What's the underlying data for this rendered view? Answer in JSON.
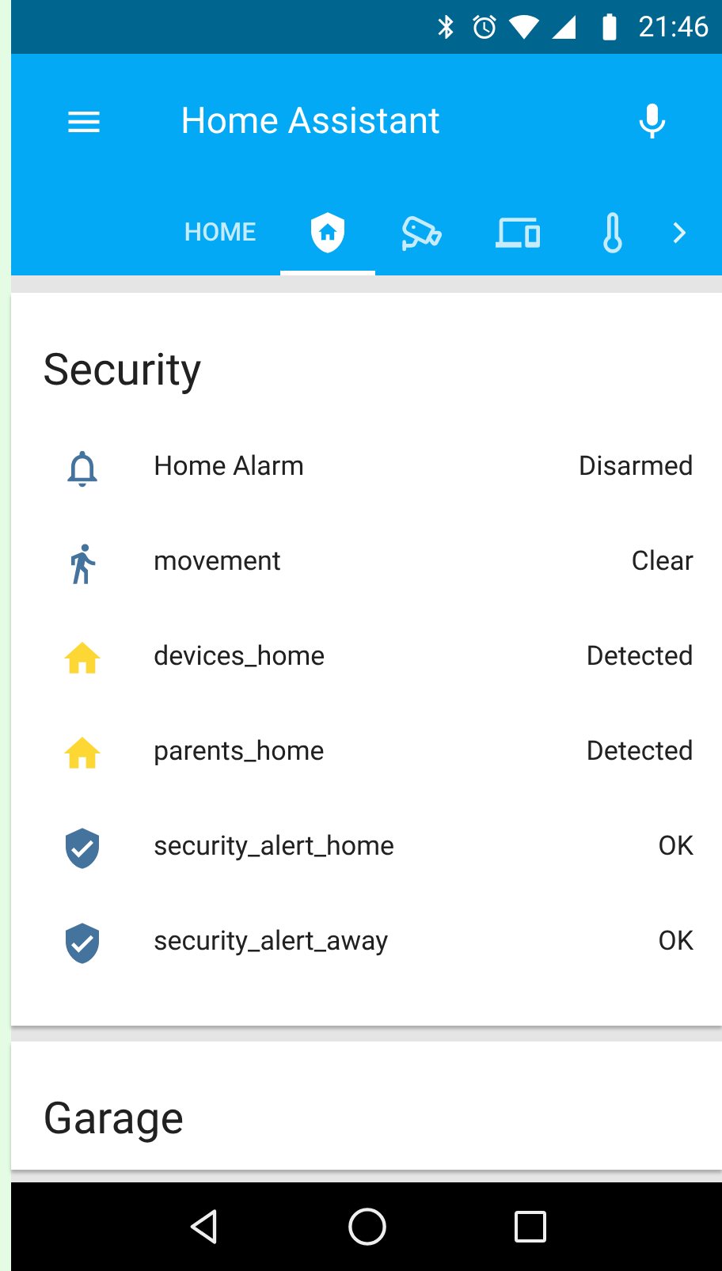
{
  "status_bar": {
    "time": "21:46"
  },
  "toolbar": {
    "title": "Home Assistant"
  },
  "tabs": [
    {
      "kind": "text",
      "label": "HOME",
      "selected": false
    },
    {
      "kind": "shield",
      "selected": true
    },
    {
      "kind": "camera",
      "selected": false
    },
    {
      "kind": "devices",
      "selected": false
    },
    {
      "kind": "thermometer",
      "selected": false
    }
  ],
  "cards": [
    {
      "title": "Security",
      "rows": [
        {
          "kind": "alarm",
          "name": "Home Alarm",
          "state": "Disarmed",
          "color": "#44739e"
        },
        {
          "kind": "motion",
          "name": "movement",
          "state": "Clear",
          "color": "#44739e"
        },
        {
          "kind": "presence",
          "name": "devices_home",
          "state": "Detected",
          "color": "#fdd835"
        },
        {
          "kind": "presence",
          "name": "parents_home",
          "state": "Detected",
          "color": "#fdd835"
        },
        {
          "kind": "alert",
          "name": "security_alert_home",
          "state": "OK",
          "color": "#44739e"
        },
        {
          "kind": "alert",
          "name": "security_alert_away",
          "state": "OK",
          "color": "#44739e"
        }
      ]
    },
    {
      "title": "Garage"
    }
  ]
}
